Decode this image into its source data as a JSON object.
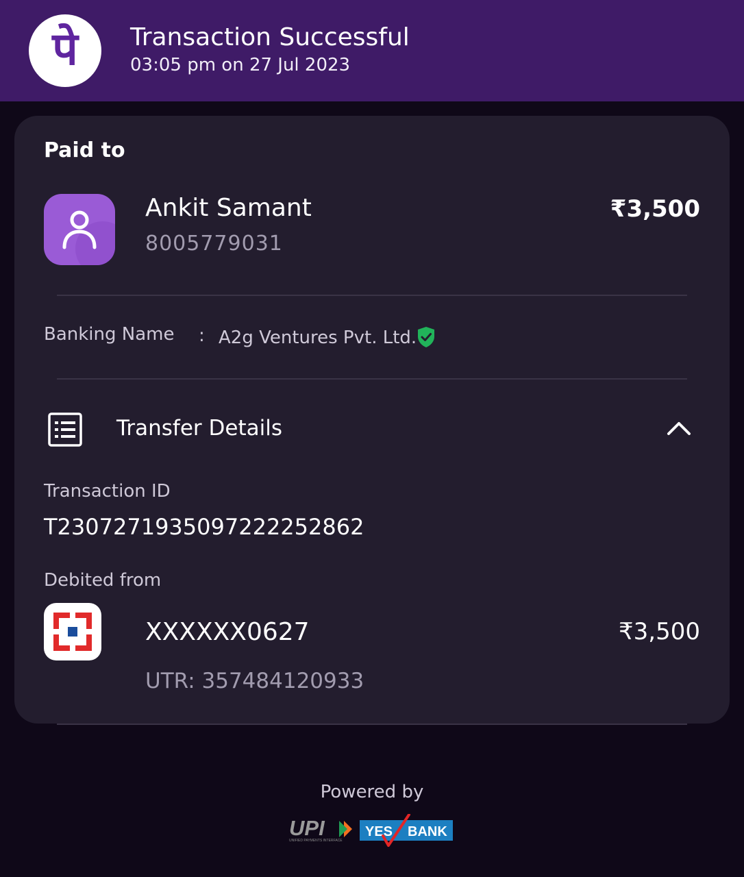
{
  "header": {
    "logo_glyph": "पे",
    "title": "Transaction Successful",
    "datetime": "03:05 pm on 27 Jul 2023",
    "background_color": "#3f1b67"
  },
  "paid_to": {
    "label": "Paid to",
    "name": "Ankit Samant",
    "phone": "8005779031",
    "amount": "₹3,500",
    "avatar_icon": "person-icon"
  },
  "banking": {
    "label": "Banking Name",
    "separator": ":",
    "value": "A2g Ventures Pvt. Ltd.",
    "verified_icon": "verified-shield-icon",
    "verified_color": "#21b35a"
  },
  "transfer_details": {
    "title": "Transfer Details",
    "icon": "receipt-list-icon",
    "toggle_icon": "chevron-up-icon",
    "transaction_id_label": "Transaction ID",
    "transaction_id": "T2307271935097222252862",
    "debited_from_label": "Debited from",
    "account": "XXXXXX0627",
    "amount": "₹3,500",
    "utr": "UTR: 357484120933",
    "bank_icon": "hdfc-bank-logo"
  },
  "footer": {
    "powered_by": "Powered by",
    "upi_text": "UPI",
    "upi_subtext": "UNIFIED PAYMENTS INTERFACE",
    "yes_text": "YES",
    "bank_text": "BANK"
  }
}
